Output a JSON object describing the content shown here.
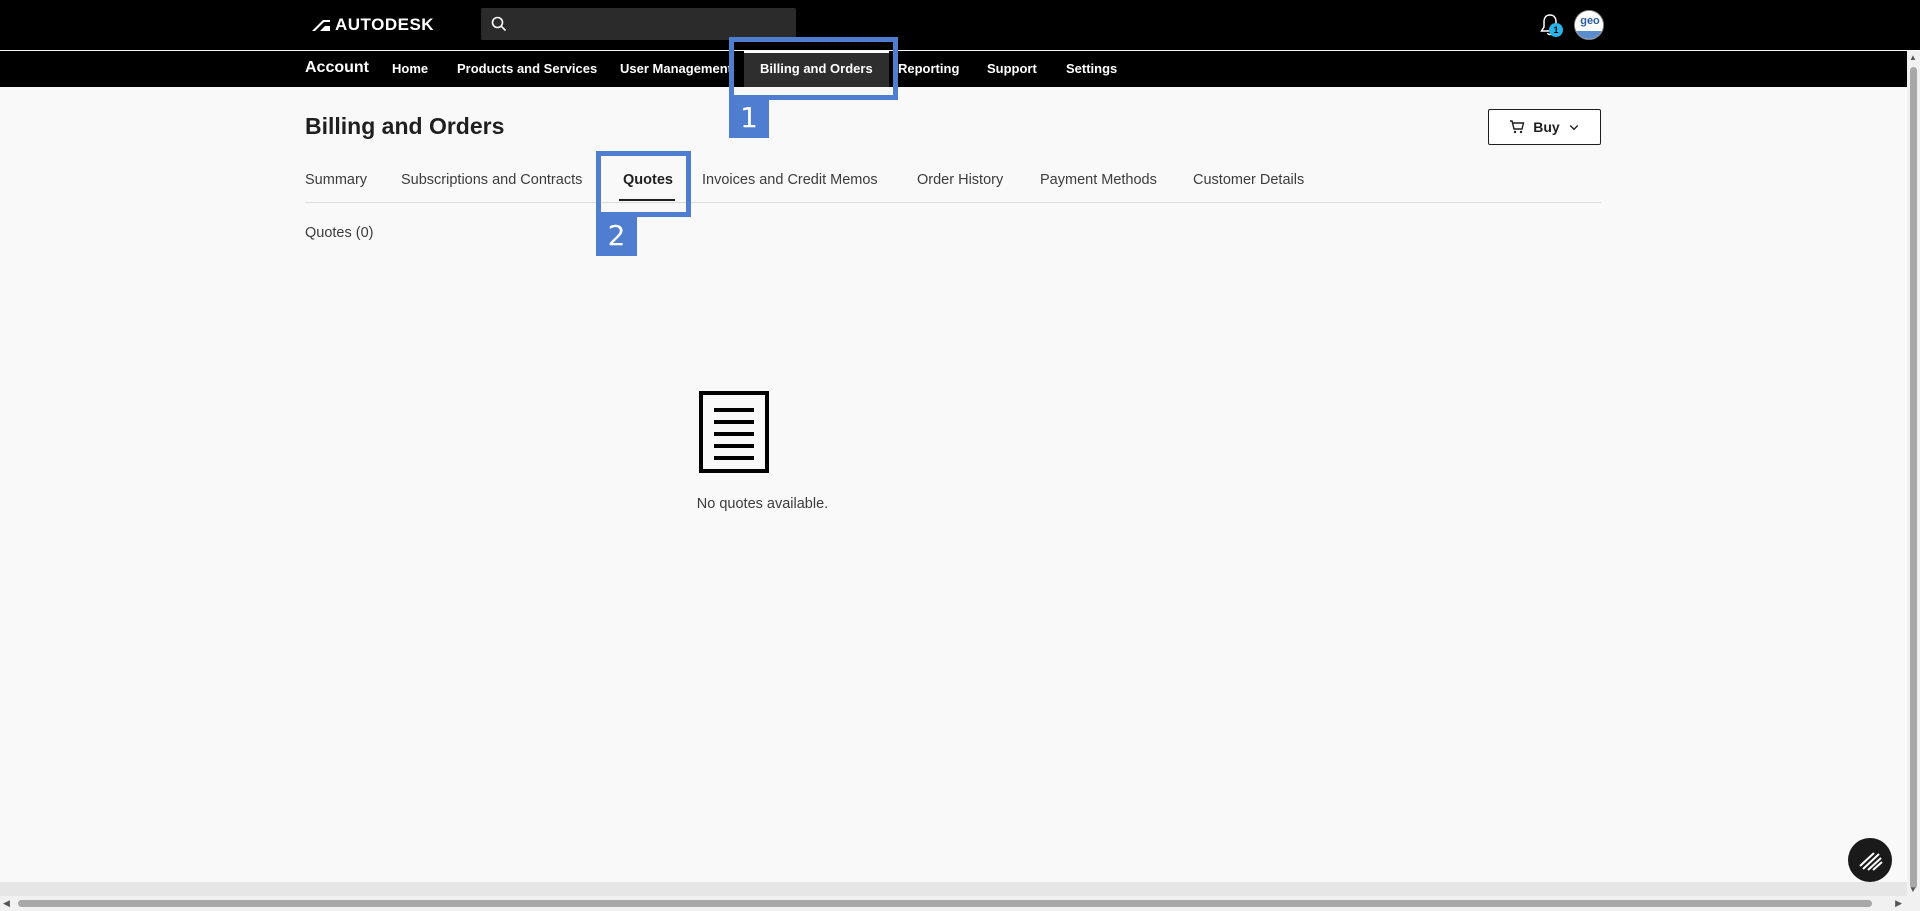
{
  "header": {
    "brand": "AUTODESK",
    "search": {
      "placeholder": "",
      "value": ""
    },
    "notifications": {
      "count": "1"
    },
    "avatar": {
      "initials": "geo"
    }
  },
  "nav": {
    "section_title": "Account",
    "items": [
      {
        "label": "Home",
        "active": false
      },
      {
        "label": "Products and Services",
        "active": false
      },
      {
        "label": "User Management",
        "active": false
      },
      {
        "label": "Billing and Orders",
        "active": true
      },
      {
        "label": "Reporting",
        "active": false
      },
      {
        "label": "Support",
        "active": false
      },
      {
        "label": "Settings",
        "active": false
      }
    ]
  },
  "page": {
    "title": "Billing and Orders",
    "buy_label": "Buy",
    "tabs": [
      {
        "label": "Summary",
        "active": false
      },
      {
        "label": "Subscriptions and Contracts",
        "active": false
      },
      {
        "label": "Quotes",
        "active": true
      },
      {
        "label": "Invoices and Credit Memos",
        "active": false
      },
      {
        "label": "Order History",
        "active": false
      },
      {
        "label": "Payment Methods",
        "active": false
      },
      {
        "label": "Customer Details",
        "active": false
      }
    ],
    "quotes_count": "Quotes (0)",
    "empty_message": "No quotes available."
  },
  "annotations": [
    {
      "label": "1",
      "target": "Billing and Orders"
    },
    {
      "label": "2",
      "target": "Quotes"
    }
  ],
  "colors": {
    "annotation": "#4f7ed1",
    "topbar": "#000000",
    "background": "#f9f9f9",
    "badge": "#2ab3e6"
  }
}
